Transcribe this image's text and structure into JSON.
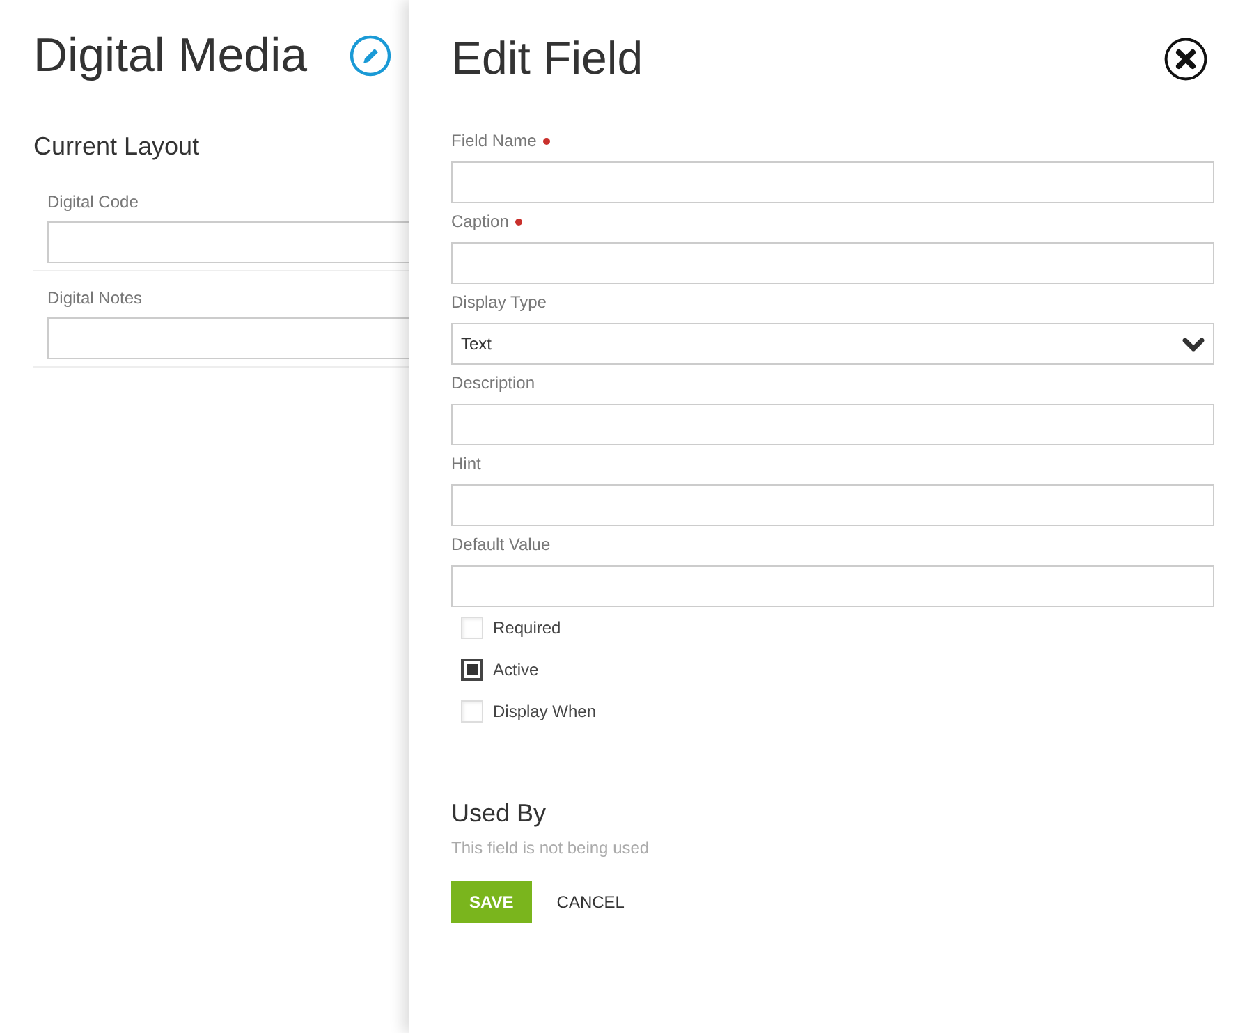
{
  "page": {
    "title": "Digital Media",
    "section_title": "Current Layout",
    "fields": [
      {
        "label": "Digital Code"
      },
      {
        "label": "Digital Notes"
      }
    ]
  },
  "drawer": {
    "title": "Edit Field",
    "fields": [
      {
        "label": "Field Name",
        "required": true,
        "kind": "text"
      },
      {
        "label": "Caption",
        "required": true,
        "kind": "text"
      },
      {
        "label": "Display Type",
        "required": false,
        "kind": "select",
        "value": "Text"
      },
      {
        "label": "Description",
        "required": false,
        "kind": "text"
      },
      {
        "label": "Hint",
        "required": false,
        "kind": "text"
      },
      {
        "label": "Default Value",
        "required": false,
        "kind": "text"
      }
    ],
    "checkboxes": [
      {
        "label": "Required",
        "checked": false
      },
      {
        "label": "Active",
        "checked": true
      },
      {
        "label": "Display When",
        "checked": false
      }
    ],
    "used_by": {
      "title": "Used By",
      "note": "This field is not being used"
    },
    "buttons": [
      {
        "label": "SAVE",
        "kind": "primary"
      },
      {
        "label": "CANCEL",
        "kind": "flat"
      }
    ]
  }
}
